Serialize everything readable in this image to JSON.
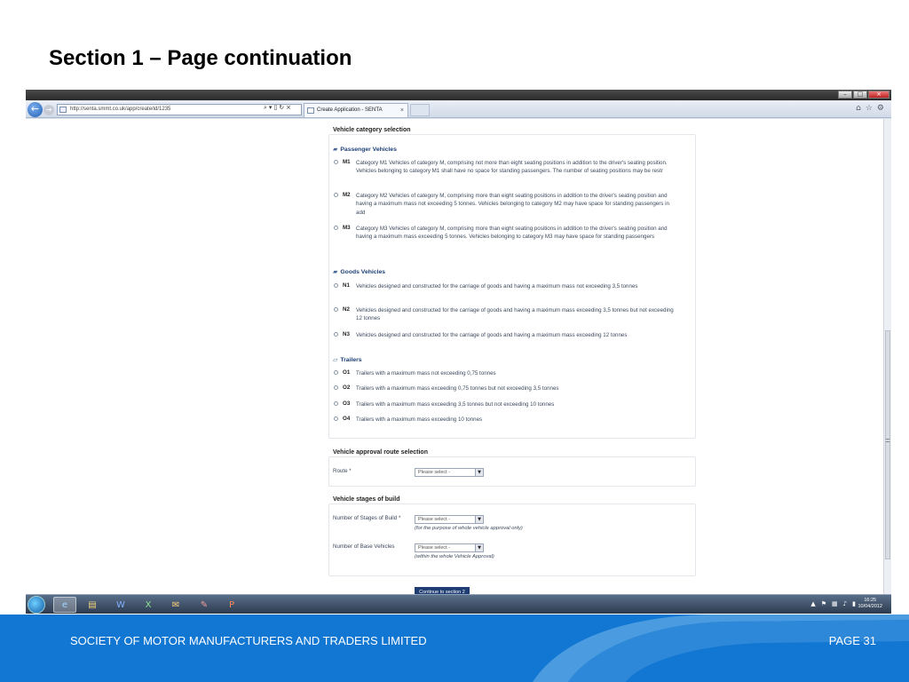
{
  "slide": {
    "title": "Section 1 – Page continuation",
    "footer_org": "SOCIETY OF MOTOR MANUFACTURERS AND TRADERS LIMITED",
    "footer_page": "PAGE 31"
  },
  "browser": {
    "url": "http://senta.smmt.co.uk/app/create/id/1235",
    "tab_label": "Create Application - SENTA",
    "tab_close": "×"
  },
  "form": {
    "vehicle_category": {
      "title": "Vehicle category selection",
      "groups": [
        {
          "title": "Passenger Vehicles",
          "icon": "car-icon",
          "options": [
            {
              "code": "M1",
              "desc": "Category M1 Vehicles of category M, comprising not more than eight seating positions in addition to the driver's seating position. Vehicles belonging to category M1 shall have no space for standing passengers. The number of seating positions may be restr"
            },
            {
              "code": "M2",
              "desc": "Category M2 Vehicles of category M, comprising more than eight seating positions in addition to the driver's seating position and having a maximum mass not exceeding 5 tonnes. Vehicles belonging to category M2 may have space for standing passengers in add"
            },
            {
              "code": "M3",
              "desc": "Category M3 Vehicles of category M, comprising more than eight seating positions in addition to the driver's seating position and having a maximum mass exceeding 5 tonnes. Vehicles belonging to category M3 may have space for standing passengers"
            }
          ]
        },
        {
          "title": "Goods Vehicles",
          "icon": "truck-icon",
          "options": [
            {
              "code": "N1",
              "desc": "Vehicles designed and constructed for the carriage of goods and having a maximum mass not exceeding 3,5 tonnes"
            },
            {
              "code": "N2",
              "desc": "Vehicles designed and constructed for the carriage of goods and having a maximum mass exceeding 3,5 tonnes but not exceeding 12 tonnes"
            },
            {
              "code": "N3",
              "desc": "Vehicles designed and constructed for the carriage of goods and having a maximum mass exceeding 12 tonnes"
            }
          ]
        },
        {
          "title": "Trailers",
          "icon": "trailer-icon",
          "options": [
            {
              "code": "O1",
              "desc": "Trailers with a maximum mass not exceeding 0,75 tonnes"
            },
            {
              "code": "O2",
              "desc": "Trailers with a maximum mass exceeding 0,75 tonnes but not exceeding 3,5 tonnes"
            },
            {
              "code": "O3",
              "desc": "Trailers with a maximum mass exceeding 3,5 tonnes but not exceeding 10 tonnes"
            },
            {
              "code": "O4",
              "desc": "Trailers with a maximum mass exceeding 10 tonnes"
            }
          ]
        }
      ]
    },
    "approval_route": {
      "title": "Vehicle approval route selection",
      "route_label": "Route *",
      "route_value": "Please select -"
    },
    "stages": {
      "title": "Vehicle stages of build",
      "stages_label": "Number of Stages of Build *",
      "stages_value": "Please select -",
      "stages_hint": "(for the purpose of whole vehicle approval only)",
      "base_label": "Number of Base Vehicles",
      "base_value": "Please select -",
      "base_hint": "(within the whole Vehicle Approval)"
    },
    "continue_label": "Continue to section 2"
  },
  "taskbar": {
    "time": "16:25",
    "date": "10/04/2012"
  }
}
